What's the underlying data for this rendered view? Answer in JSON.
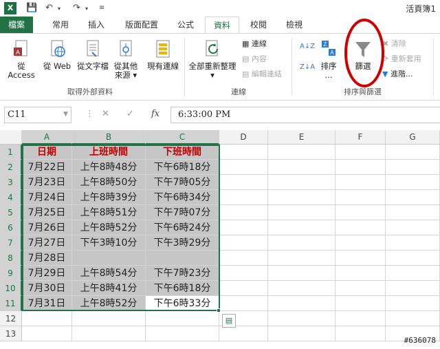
{
  "window": {
    "title": "活頁簿1"
  },
  "tabs": [
    {
      "label": "檔案"
    },
    {
      "label": "常用"
    },
    {
      "label": "插入"
    },
    {
      "label": "版面配置"
    },
    {
      "label": "公式"
    },
    {
      "label": "資料"
    },
    {
      "label": "校閱"
    },
    {
      "label": "檢視"
    }
  ],
  "ribbon": {
    "external": {
      "access": "從 Access",
      "web": "從 Web",
      "text": "從文字檔",
      "other1": "從其他",
      "other2": "來源",
      "existing": "現有連線",
      "group": "取得外部資料"
    },
    "connections": {
      "refresh": "全部重新整理",
      "conn": "連線",
      "props": "內容",
      "edit": "編輯連結",
      "group": "連線"
    },
    "sort": {
      "sort_label": "排序",
      "filter": "篩選",
      "clear": "清除",
      "reapply": "重新套用",
      "advanced": "進階...",
      "group": "排序與篩選"
    }
  },
  "formula_bar": {
    "name_box": "C11",
    "fx": "fx",
    "formula": "6:33:00 PM"
  },
  "columns": [
    "A",
    "B",
    "C",
    "D",
    "E",
    "F",
    "G"
  ],
  "rows": [
    "1",
    "2",
    "3",
    "4",
    "5",
    "6",
    "7",
    "8",
    "9",
    "10",
    "11",
    "12",
    "13"
  ],
  "table": {
    "headers": [
      "日期",
      "上班時間",
      "下班時間"
    ],
    "data": [
      [
        "7月22日",
        "上午8時48分",
        "下午6時18分"
      ],
      [
        "7月23日",
        "上午8時50分",
        "下午7時05分"
      ],
      [
        "7月24日",
        "上午8時39分",
        "下午6時34分"
      ],
      [
        "7月25日",
        "上午8時51分",
        "下午7時07分"
      ],
      [
        "7月26日",
        "上午8時52分",
        "下午6時24分"
      ],
      [
        "7月27日",
        "下午3時10分",
        "下午3時29分"
      ],
      [
        "7月28日",
        "",
        ""
      ],
      [
        "7月29日",
        "上午8時54分",
        "下午7時23分"
      ],
      [
        "7月30日",
        "上午8時41分",
        "下午6時18分"
      ],
      [
        "7月31日",
        "上午8時52分",
        "下午6時33分"
      ]
    ]
  },
  "watermark": "#636078",
  "colors": {
    "accent": "#217346",
    "header_text": "#c00000",
    "selection_fill": "#c6c6c6",
    "annotation": "#d00000"
  }
}
